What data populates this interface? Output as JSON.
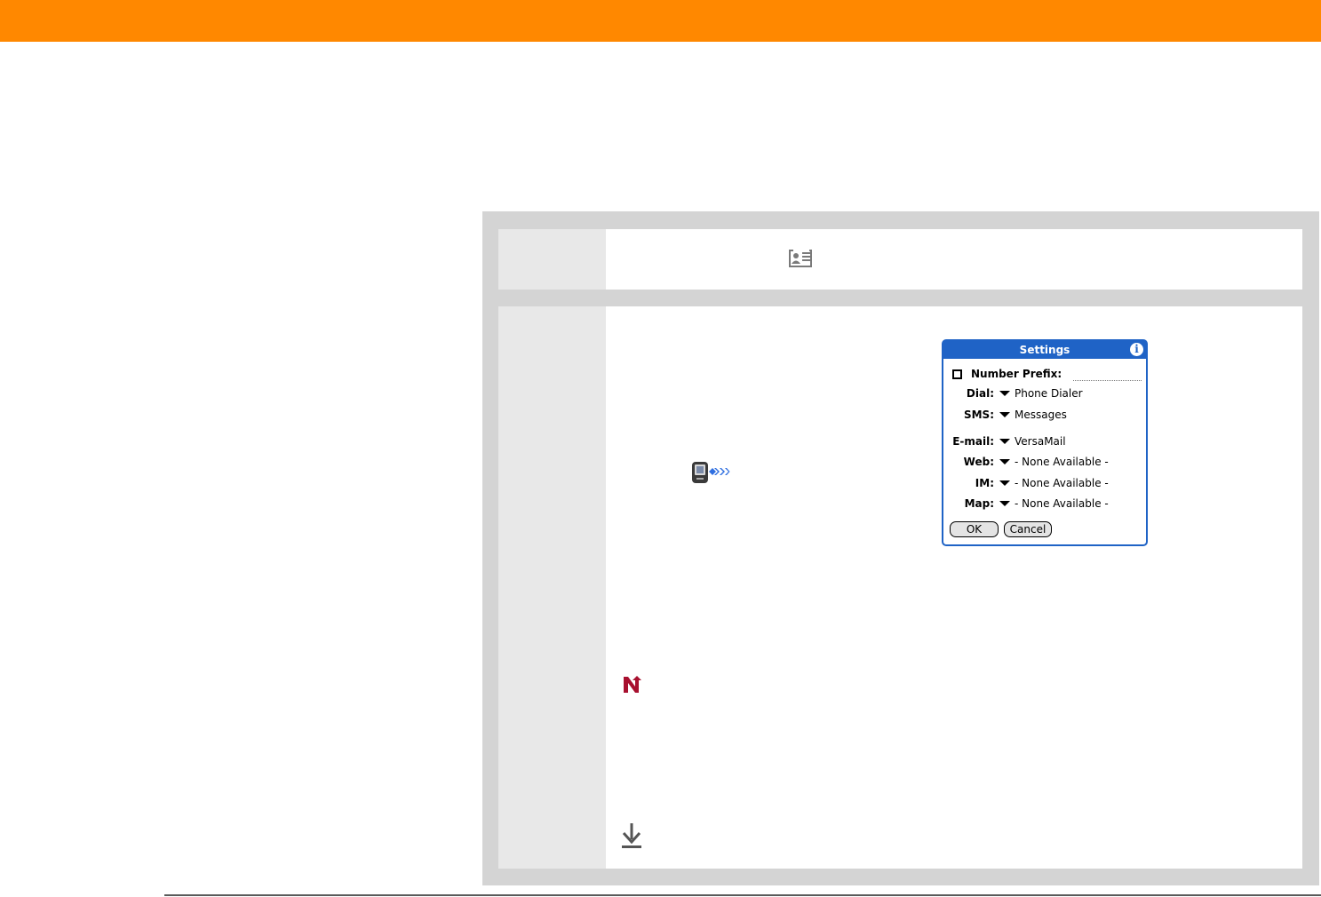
{
  "colors": {
    "header_accent": "#FF8800",
    "frame_gray": "#D4D4D4",
    "number_column_gray": "#E8E8E8",
    "dialog_blue": "#1F63C6",
    "tip_red": "#A8102F"
  },
  "icons": {
    "step1": "contacts-icon",
    "step2": "palm-handheld-beam-icon",
    "tip": "tip-icon",
    "continue": "continue-arrow-icon",
    "dialog_info": "info-icon",
    "dropdown": "dropdown-triangle-icon"
  },
  "settings_dialog": {
    "title": "Settings",
    "info_glyph": "i",
    "number_prefix_label": "Number Prefix:",
    "number_prefix_checked": false,
    "rows": [
      {
        "label": "Dial:",
        "value": "Phone Dialer"
      },
      {
        "label": "SMS:",
        "value": "Messages"
      },
      {
        "label": "E-mail:",
        "value": "VersaMail"
      },
      {
        "label": "Web:",
        "value": "- None Available -"
      },
      {
        "label": "IM:",
        "value": "- None Available -"
      },
      {
        "label": "Map:",
        "value": "- None Available -"
      }
    ],
    "ok_label": "OK",
    "cancel_label": "Cancel"
  }
}
